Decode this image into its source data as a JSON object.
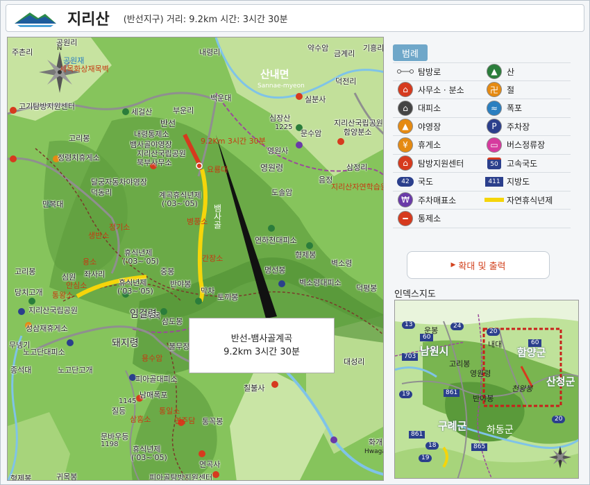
{
  "header": {
    "title": "지리산",
    "subtitle": "(반선지구) 거리: 9.2km  시간: 3시간 30분"
  },
  "map": {
    "route_label": "9.2Km 3시간 30분",
    "callout_line1": "반선-뱀사골계곡",
    "callout_line2": "9.2km 3시간 30분",
    "labels": {
      "l01": "공원리",
      "l02": "주촌리",
      "l03": "공원재",
      "l04": "세목화상재목벽",
      "l05": "내령리",
      "l06": "약수암",
      "l07": "금계리",
      "l08": "기흥리",
      "l09": "산내면",
      "l10": "Sannae-myeon",
      "l11": "덕전리",
      "l12": "실분사",
      "l13": "고기탐방지원센터",
      "l14": "세걸산",
      "l15": "부운리",
      "l16": "심장산",
      "l17": "1225",
      "l18": "문수암",
      "l19": "지리산국립공원",
      "l20": "함양분소",
      "l21": "반선",
      "l22": "내령통제소",
      "l23": "백운대",
      "l24": "뱀사골야영장",
      "l25": "지리산국립공원",
      "l26": "북부사무소",
      "l27": "고리봉",
      "l28": "정령치휴게소",
      "l29": "영원사",
      "l30": "요룡대",
      "l31": "영원령",
      "l32": "삼정리",
      "l33": "달궁자동차야영장",
      "l34": "덕동리",
      "l35": "계곡휴식년제",
      "l36": "('03~'05)",
      "l37": "도솔암",
      "l38": "음정",
      "l39": "지리산자연학습원",
      "l40": "만복대",
      "l41": "병풍소",
      "l42": "뱀사골",
      "l43": "정기소",
      "l44": "연하천대피소",
      "l45": "생반소",
      "l46": "휴식년제",
      "l47": "('03~'05)",
      "l48": "형제봉",
      "l49": "벽소령",
      "l50": "고리봉",
      "l51": "용소",
      "l52": "간장소",
      "l53": "중봉",
      "l54": "명선봉",
      "l55": "당치고개",
      "l56": "심원",
      "l57": "좌사리",
      "l58": "휴식년제",
      "l59": "('03~'05)",
      "l60": "반야봉",
      "l61": "막차",
      "l62": "벽소령대피소",
      "l63": "덕평봉",
      "l64": "안심소",
      "l65": "통왕소",
      "l66": "토끼봉",
      "l67": "지리산국립공원",
      "l68": "노루목",
      "l69": "임걸령",
      "l70": "돼지령",
      "l71": "성삼재휴게소",
      "l72": "삼도봉",
      "l73": "무넹기",
      "l74": "노고단대피소",
      "l75": "노고단고개",
      "l76": "불무장등",
      "l77": "용수암",
      "l78": "피아골대피소",
      "l79": "남매폭포",
      "l80": "질등",
      "l81": "1145",
      "l82": "통일소",
      "l83": "삼홍소",
      "l84": "연주담",
      "l85": "문바우등",
      "l86": "1198",
      "l87": "통꼭봉",
      "l88": "휴식년제",
      "l89": "('03~'05)",
      "l90": "연곡사",
      "l91": "칠불사",
      "l92": "대성리",
      "l93": "종석대",
      "l94": "화개",
      "l95": "Hwagae",
      "l96": "형제봉",
      "l97": "피아골탐방지원센터",
      "l98": "귀목봉"
    }
  },
  "legend": {
    "tab_label": "범례",
    "items": [
      {
        "label": "탐방로",
        "icon": "trail-icon"
      },
      {
        "label": "산",
        "icon": "mountain-icon"
      },
      {
        "label": "사무소 · 분소",
        "icon": "office-icon"
      },
      {
        "label": "절",
        "icon": "temple-icon"
      },
      {
        "label": "대피소",
        "icon": "shelter-icon"
      },
      {
        "label": "폭포",
        "icon": "waterfall-icon"
      },
      {
        "label": "야영장",
        "icon": "campsite-icon"
      },
      {
        "label": "주차장",
        "icon": "parking-icon"
      },
      {
        "label": "휴게소",
        "icon": "rest-area-icon"
      },
      {
        "label": "버스정류장",
        "icon": "bus-stop-icon"
      },
      {
        "label": "탐방지원센터",
        "icon": "visitor-center-icon"
      },
      {
        "label": "고속국도",
        "icon": "expressway-icon",
        "number": "50"
      },
      {
        "label": "국도",
        "icon": "national-road-icon",
        "number": "42"
      },
      {
        "label": "지방도",
        "icon": "local-road-icon",
        "number": "411"
      },
      {
        "label": "주차매표소",
        "icon": "ticket-office-icon"
      },
      {
        "label": "자연휴식년제",
        "icon": "rest-period-icon"
      },
      {
        "label": "통제소",
        "icon": "control-post-icon"
      }
    ],
    "colors": {
      "red": "#d63a1e",
      "green": "#2b7d3b",
      "blue": "#2a7fc0",
      "orange": "#e58a12",
      "yellow": "#f5d50a",
      "purple": "#6a3aa8",
      "navy": "#2b3f8c"
    }
  },
  "zoom_button": {
    "label": "확대 및 출력",
    "arrow": "▶"
  },
  "index_map": {
    "title": "인덱스지도",
    "labels": {
      "i01": "운봉",
      "i02": "24",
      "i03": "60",
      "i04": "남원시",
      "i05": "703",
      "i06": "고리봉",
      "i07": "영원령",
      "i08": "함양군",
      "i09": "60",
      "i10": "천왕봉",
      "i11": "산청군",
      "i12": "19",
      "i13": "861",
      "i14": "반야봉",
      "i15": "구례군",
      "i16": "하동군",
      "i17": "861",
      "i18": "18",
      "i19": "865",
      "i20": "19",
      "i21": "20",
      "i22": "20",
      "i23": "13",
      "i24": "내대"
    }
  }
}
